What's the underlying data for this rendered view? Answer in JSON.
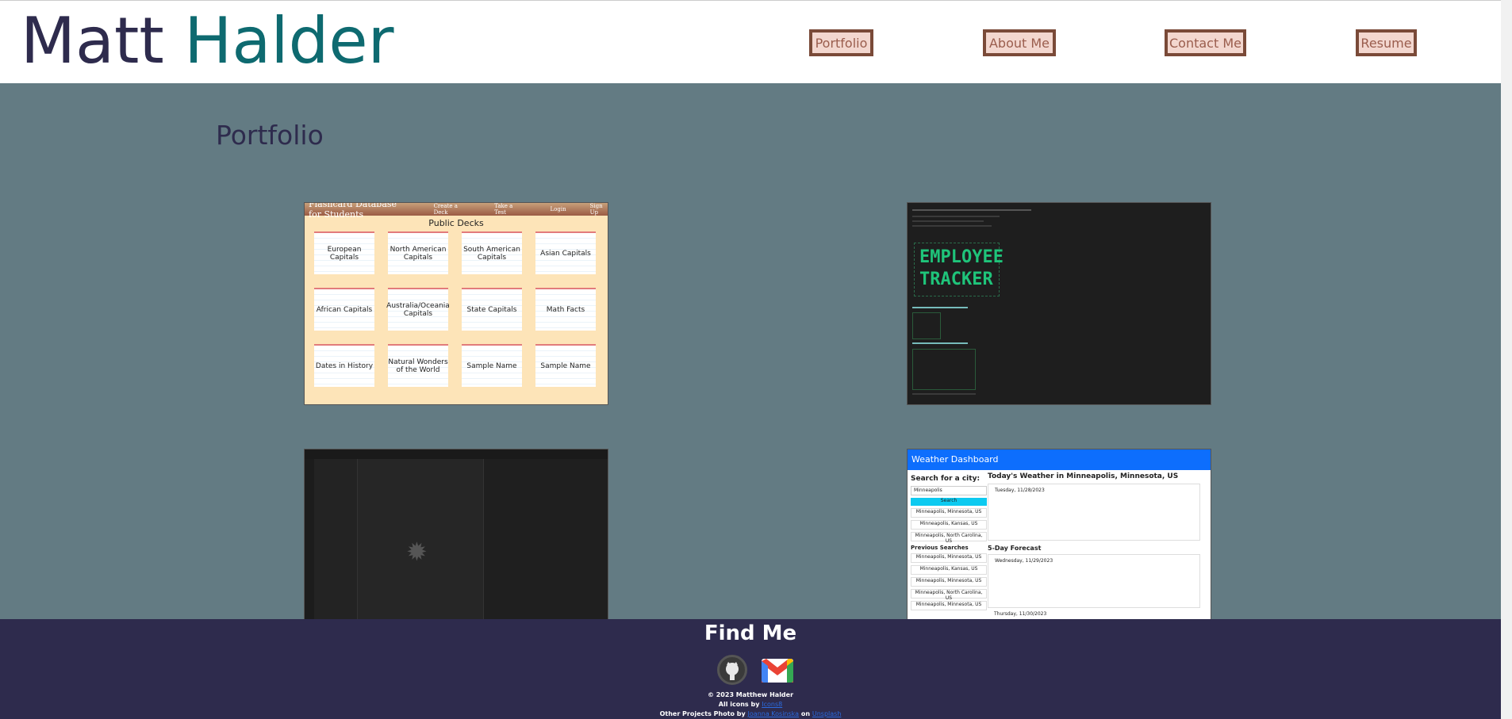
{
  "header": {
    "first_name": "Matt",
    "last_name": "Halder",
    "nav": [
      {
        "label": "Portfolio"
      },
      {
        "label": "About Me"
      },
      {
        "label": "Contact Me"
      },
      {
        "label": "Resume"
      }
    ]
  },
  "main": {
    "title": "Portfolio",
    "projects": {
      "flashcard": {
        "app_title": "Flashcard Database for Students",
        "nav": [
          "Create a Deck",
          "Take a Test",
          "Login",
          "Sign Up"
        ],
        "heading": "Public Decks",
        "decks": [
          "European Capitals",
          "North American Capitals",
          "South American Capitals",
          "Asian Capitals",
          "African Capitals",
          "Australia/Oceania Capitals",
          "State Capitals",
          "Math Facts",
          "Dates in History",
          "Natural Wonders of the World",
          "Sample Name",
          "Sample Name"
        ]
      },
      "employee_tracker": {
        "logo_line1": "EMPLOYEE",
        "logo_line2": "TRACKER"
      },
      "weather": {
        "header": "Weather Dashboard",
        "search_label": "Search for a city:",
        "search_value": "Minneapolis",
        "search_button": "Search",
        "results": [
          "Minneapolis, Minnesota, US",
          "Minneapolis, Kansas, US",
          "Minneapolis, North Carolina, US"
        ],
        "previous_label": "Previous Searches",
        "previous": [
          "Minneapolis, Minnesota, US",
          "Minneapolis, Kansas, US",
          "Minneapolis, Minnesota, US",
          "Minneapolis, North Carolina, US",
          "Minneapolis, Minnesota, US"
        ],
        "today_title": "Today's Weather in Minneapolis, Minnesota, US",
        "today_date": "Tuesday, 11/28/2023",
        "forecast_title": "5-Day Forecast",
        "forecast_day1": "Wednesday, 11/29/2023",
        "forecast_day2": "Thursday, 11/30/2023"
      }
    }
  },
  "footer": {
    "title": "Find Me",
    "copyright": "© 2023 Matthew Halder",
    "icons_prefix": "All icons by",
    "icons_link": "Icons8",
    "photo_prefix": "Other Projects Photo by",
    "photo_author": "Joanna Kosinska",
    "photo_on": "on",
    "photo_site": "Unsplash"
  },
  "colors": {
    "header_bg": "#ffffff",
    "name_first": "#2e2b4d",
    "name_last": "#0e6a70",
    "page_bg": "#637b83",
    "footer_bg": "#2e2b4d",
    "nav_border": "#7a4a38",
    "nav_bg": "#f3d7cf"
  }
}
